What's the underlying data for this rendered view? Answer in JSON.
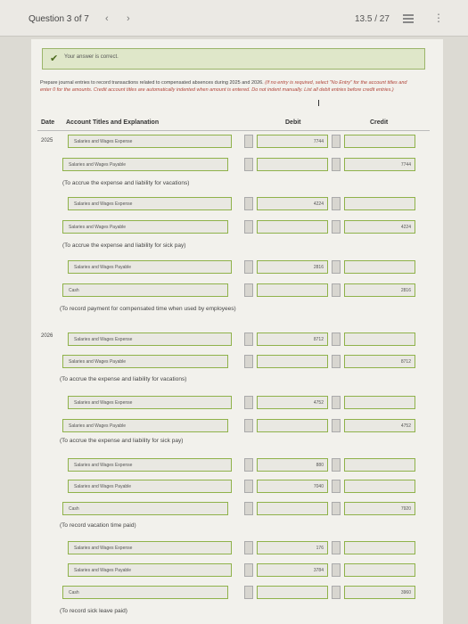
{
  "header": {
    "question": "Question 3 of 7",
    "prev": "‹",
    "next": "›",
    "score": "13.5 / 27",
    "more": "⋮"
  },
  "banner": {
    "check": "✔",
    "text": "Your answer is correct."
  },
  "instructions": {
    "main": "Prepare journal entries to record transactions related to compensated absences during 2025 and 2026.",
    "red": "(If no entry is required, select \"No Entry\" for the account titles and enter 0 for the amounts. Credit account titles are automatically indented when amount is entered. Do not indent manually. List all debit entries before credit entries.)"
  },
  "columns": {
    "date": "Date",
    "account": "Account Titles and Explanation",
    "debit": "Debit",
    "credit": "Credit"
  },
  "dates": {
    "y2025": "2025",
    "y2026": "2026"
  },
  "rows": [
    {
      "account": "Salaries and Wages Expense",
      "debit": "7744",
      "credit": ""
    },
    {
      "account": "Salaries and Wages Payable",
      "debit": "",
      "credit": "7744"
    },
    {
      "account": "Salaries and Wages Expense",
      "debit": "4224",
      "credit": ""
    },
    {
      "account": "Salaries and Wages Payable",
      "debit": "",
      "credit": "4224"
    },
    {
      "account": "Salaries and Wages Payable",
      "debit": "2816",
      "credit": ""
    },
    {
      "account": "Cash",
      "debit": "",
      "credit": "2816"
    },
    {
      "account": "Salaries and Wages Expense",
      "debit": "8712",
      "credit": ""
    },
    {
      "account": "Salaries and Wages Payable",
      "debit": "",
      "credit": "8712"
    },
    {
      "account": "Salaries and Wages Expense",
      "debit": "4752",
      "credit": ""
    },
    {
      "account": "Salaries and Wages Payable",
      "debit": "",
      "credit": "4752"
    },
    {
      "account": "Salaries and Wages Expense",
      "debit": "880",
      "credit": ""
    },
    {
      "account": "Salaries and Wages Payable",
      "debit": "7040",
      "credit": ""
    },
    {
      "account": "Cash",
      "debit": "",
      "credit": "7920"
    },
    {
      "account": "Salaries and Wages Expense",
      "debit": "176",
      "credit": ""
    },
    {
      "account": "Salaries and Wages Payable",
      "debit": "3784",
      "credit": ""
    },
    {
      "account": "Cash",
      "debit": "",
      "credit": "3960"
    }
  ],
  "notes": [
    "(To accrue the expense and liability for vacations)",
    "(To accrue the expense and liability for sick pay)",
    "(To record payment for compensated time when used by employees)",
    "(To accrue the expense and liability for vacations)",
    "(To accrue the expense and liability for sick pay)",
    "(To record vacation time paid)",
    "(To record sick leave paid)"
  ]
}
